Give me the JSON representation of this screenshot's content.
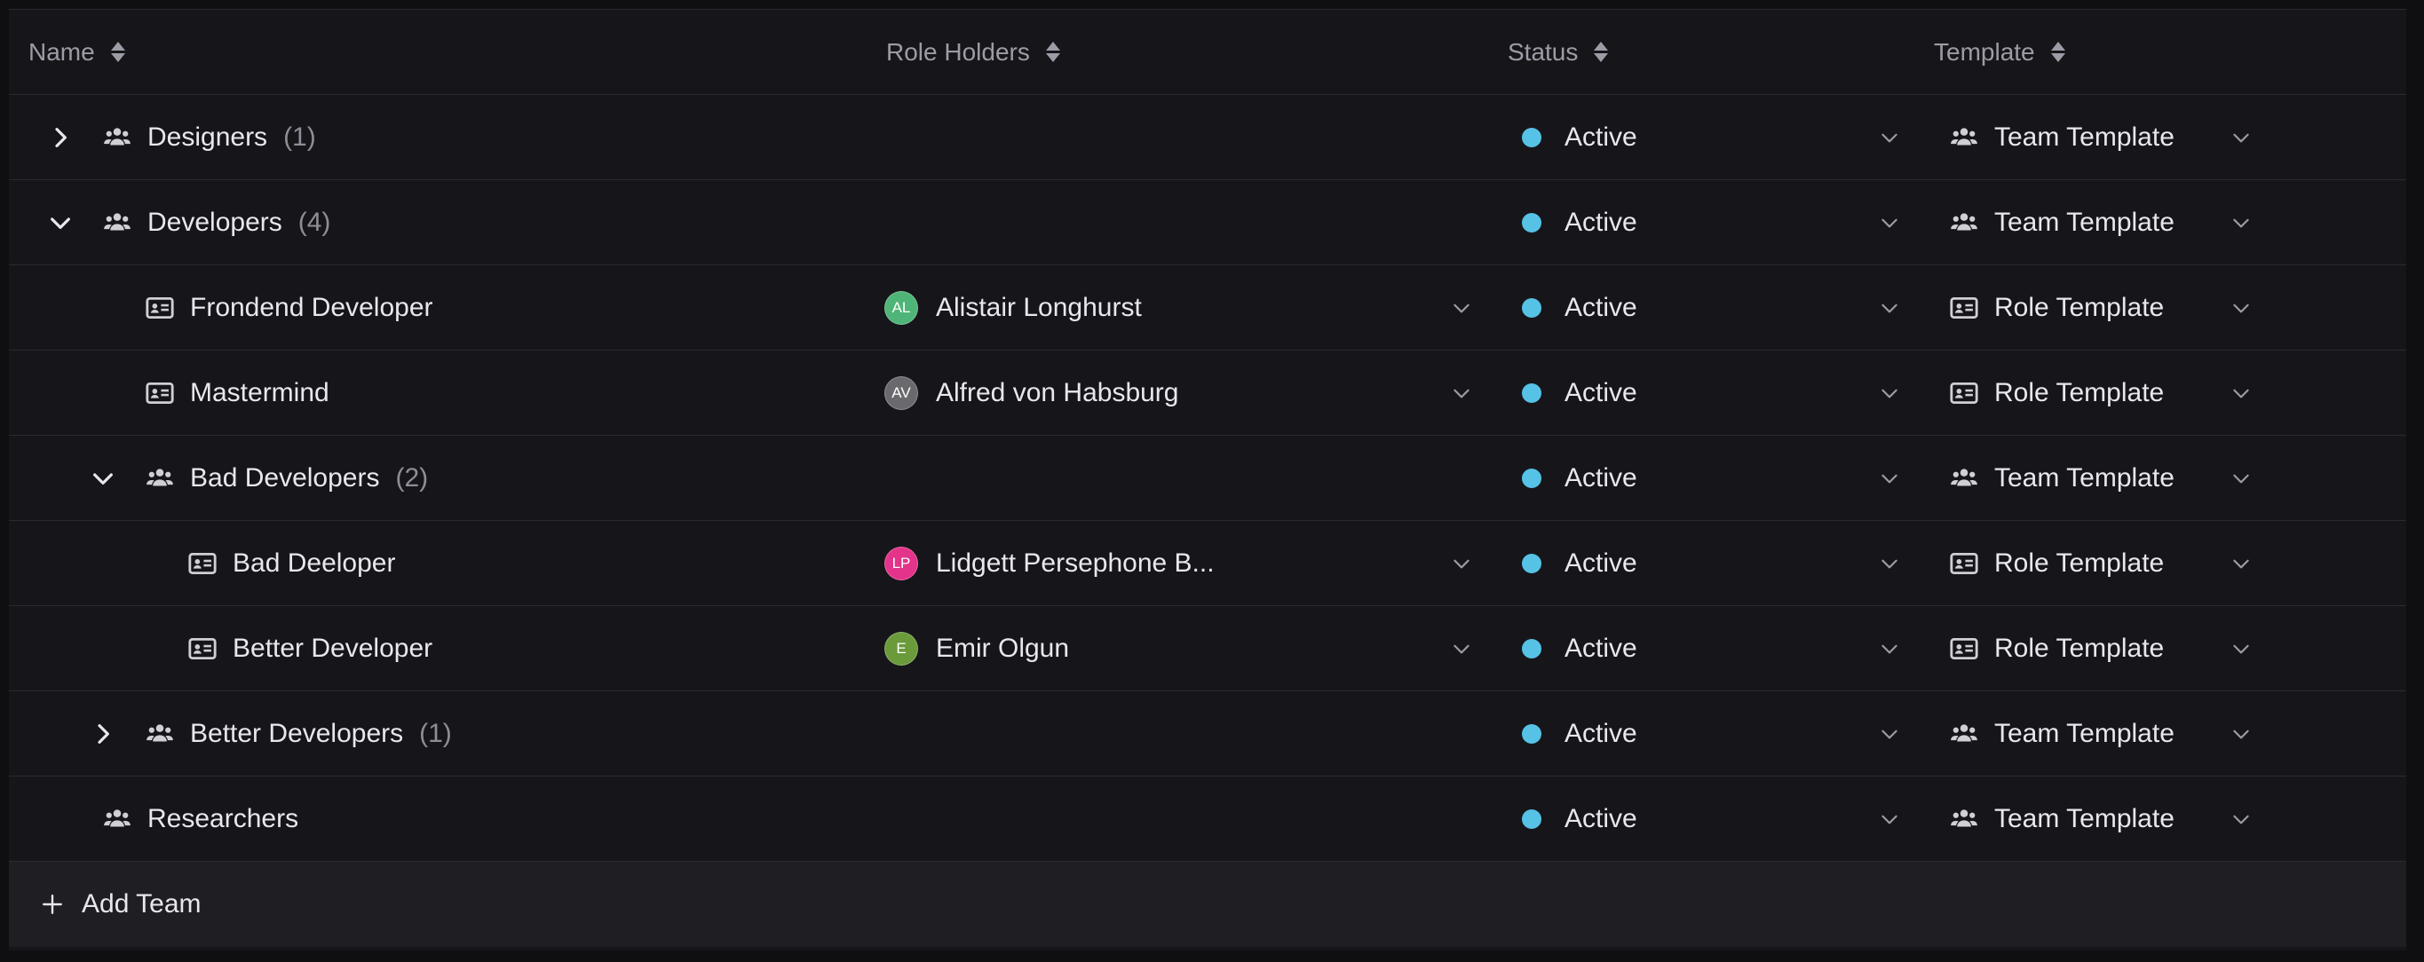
{
  "headers": {
    "name": "Name",
    "role_holders": "Role Holders",
    "status": "Status",
    "template": "Template"
  },
  "rows": [
    {
      "name": "Designers",
      "count": "(1)",
      "type": "team",
      "expanded": false,
      "status": "Active",
      "template": "Team Template",
      "holder": null
    },
    {
      "name": "Developers",
      "count": "(4)",
      "type": "team",
      "expanded": true,
      "status": "Active",
      "template": "Team Template",
      "holder": null
    },
    {
      "name": "Frondend Developer",
      "type": "role",
      "status": "Active",
      "template": "Role Template",
      "holder": {
        "initials": "AL",
        "name": "Alistair Longhurst",
        "color": "#4fb477"
      }
    },
    {
      "name": "Mastermind",
      "type": "role",
      "status": "Active",
      "template": "Role Template",
      "holder": {
        "initials": "AV",
        "name": "Alfred von Habsburg",
        "color": "#6a6a6e"
      }
    },
    {
      "name": "Bad Developers",
      "count": "(2)",
      "type": "team",
      "expanded": true,
      "status": "Active",
      "template": "Team Template",
      "holder": null
    },
    {
      "name": "Bad Deeloper",
      "type": "role",
      "status": "Active",
      "template": "Role Template",
      "holder": {
        "initials": "LP",
        "name": "Lidgett Persephone B...",
        "color": "#e3338a"
      }
    },
    {
      "name": "Better Developer",
      "type": "role",
      "status": "Active",
      "template": "Role Template",
      "holder": {
        "initials": "E",
        "name": "Emir Olgun",
        "color": "#6a9a3a"
      }
    },
    {
      "name": "Better Developers",
      "count": "(1)",
      "type": "team",
      "expanded": false,
      "status": "Active",
      "template": "Team Template",
      "holder": null
    },
    {
      "name": "Researchers",
      "type": "team",
      "status": "Active",
      "template": "Team Template",
      "holder": null
    }
  ],
  "add_team": "Add Team",
  "colors": {
    "status_active": "#56c2e6",
    "background": "#16161a"
  }
}
